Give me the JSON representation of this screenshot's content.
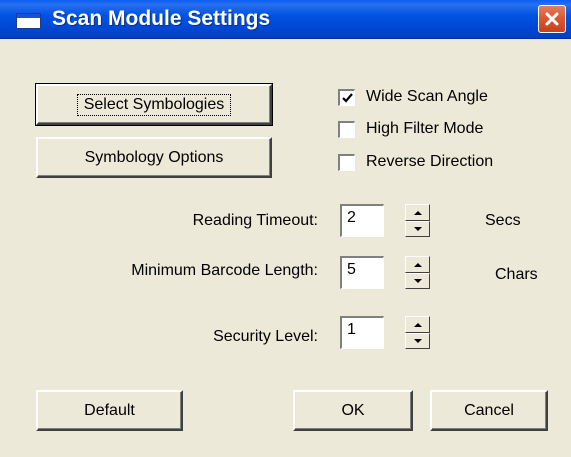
{
  "window": {
    "title": "Scan Module Settings",
    "title_icon": "window-icon",
    "close_icon": "close-icon"
  },
  "buttons": {
    "select_symbologies": "Select Symbologies",
    "symbology_options": "Symbology Options",
    "default": "Default",
    "ok": "OK",
    "cancel": "Cancel"
  },
  "checkboxes": [
    {
      "label": "Wide Scan Angle",
      "checked": true
    },
    {
      "label": "High Filter Mode",
      "checked": false
    },
    {
      "label": "Reverse Direction",
      "checked": false
    }
  ],
  "fields": [
    {
      "label": "Reading Timeout:",
      "value": "2",
      "unit": "Secs"
    },
    {
      "label": "Minimum Barcode Length:",
      "value": "5",
      "unit": "Chars"
    },
    {
      "label": "Security Level:",
      "value": "1",
      "unit": ""
    }
  ],
  "colors": {
    "titlebar": "#0053e1",
    "dialog_bg": "#ece9d8",
    "close_button": "#d85a37"
  }
}
